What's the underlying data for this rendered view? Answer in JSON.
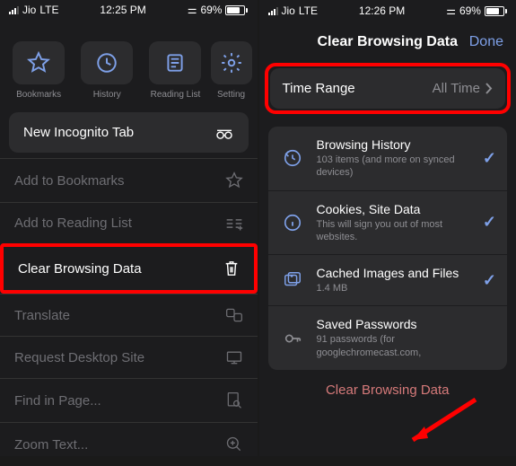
{
  "left": {
    "status": {
      "carrier": "Jio",
      "net": "LTE",
      "time": "12:25 PM",
      "battery": "69%",
      "car": "🚗"
    },
    "quick": [
      {
        "label": "Bookmarks"
      },
      {
        "label": "History"
      },
      {
        "label": "Reading List"
      },
      {
        "label": "Setting"
      }
    ],
    "incognito": "New Incognito Tab",
    "menu": [
      {
        "label": "Add to Bookmarks"
      },
      {
        "label": "Add to Reading List"
      },
      {
        "label": "Clear Browsing Data"
      },
      {
        "label": "Translate"
      },
      {
        "label": "Request Desktop Site"
      },
      {
        "label": "Find in Page..."
      },
      {
        "label": "Zoom Text..."
      }
    ]
  },
  "right": {
    "status": {
      "carrier": "Jio",
      "net": "LTE",
      "time": "12:26 PM",
      "battery": "69%"
    },
    "header": {
      "title": "Clear Browsing Data",
      "done": "Done"
    },
    "range": {
      "label": "Time Range",
      "value": "All Time"
    },
    "items": [
      {
        "title": "Browsing History",
        "sub": "103 items (and more on synced devices)",
        "checked": true
      },
      {
        "title": "Cookies, Site Data",
        "sub": "This will sign you out of most websites.",
        "checked": true
      },
      {
        "title": "Cached Images and Files",
        "sub": "1.4 MB",
        "checked": true
      },
      {
        "title": "Saved Passwords",
        "sub": "91 passwords (for googlechromecast.com,",
        "checked": false
      }
    ],
    "clear": "Clear Browsing Data"
  }
}
